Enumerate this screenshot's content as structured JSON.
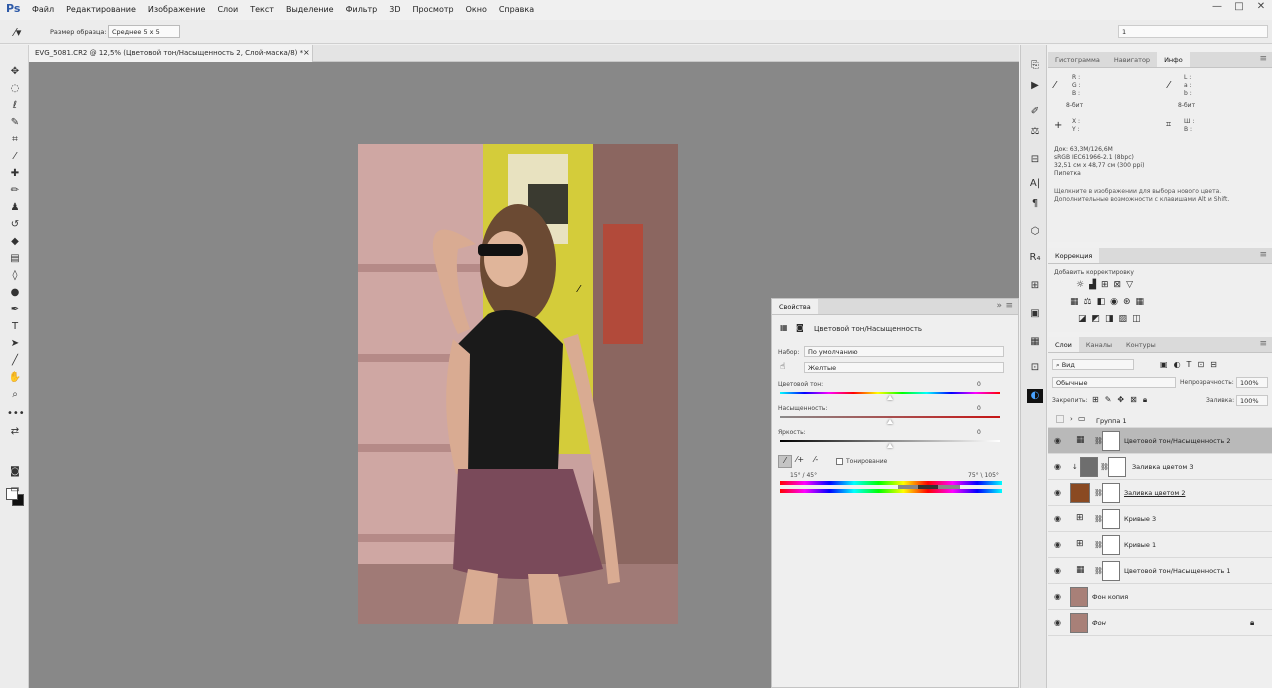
{
  "app": {
    "logo": "Ps"
  },
  "menu": [
    "Файл",
    "Редактирование",
    "Изображение",
    "Слои",
    "Текст",
    "Выделение",
    "Фильтр",
    "3D",
    "Просмотр",
    "Окно",
    "Справка"
  ],
  "window_controls": [
    "—",
    "□",
    "✕"
  ],
  "options": {
    "sample_label": "Размер образца:",
    "sample_value": "Среднее 5 x 5",
    "right_value": "1"
  },
  "document": {
    "tab_title": "EVG_5081.CR2 @ 12,5% (Цветовой тон/Насыщенность 2, Слой-маска/8) *",
    "close": "×"
  },
  "info_panel": {
    "tabs": [
      "Гистограмма",
      "Навигатор",
      "Инфо"
    ],
    "active_tab": "Инфо",
    "rgb": [
      "R :",
      "G :",
      "B :"
    ],
    "lab": [
      "L :",
      "a :",
      "b :"
    ],
    "bit_left": "8-бит",
    "bit_right": "8-бит",
    "xy": [
      "X :",
      "Y :"
    ],
    "wh": [
      "Ш :",
      "В :"
    ],
    "doc_info": [
      "Док: 63,3M/126,6M",
      "sRGB IEC61966-2.1 (8bpc)",
      "32,51 см x 48,77 см (300 ppi)",
      "Пипетка"
    ],
    "hint": [
      "Щелкните в изображении для выбора нового цвета.",
      "Дополнительные возможности с клавишами Alt и Shift."
    ]
  },
  "adjustments": {
    "tab": "Коррекция",
    "add_label": "Добавить корректировку"
  },
  "layers": {
    "tabs": [
      "Слои",
      "Каналы",
      "Контуры"
    ],
    "active_tab": "Слои",
    "filter": "Вид",
    "blend_mode": "Обычные",
    "opacity_label": "Непрозрачность:",
    "opacity": "100%",
    "lock_label": "Закрепить:",
    "fill_label": "Заливка:",
    "fill": "100%",
    "group": "Группа 1",
    "rows": [
      {
        "name": "Цветовой тон/Насыщенность 2"
      },
      {
        "name": "Заливка цветом 3"
      },
      {
        "name": "Заливка цветом 2"
      },
      {
        "name": "Кривые 3"
      },
      {
        "name": "Кривые 1"
      },
      {
        "name": "Цветовой тон/Насыщенность 1"
      },
      {
        "name": "Фон копия"
      },
      {
        "name": "Фон"
      }
    ],
    "fill2_color": "#8a4a22",
    "fill3_color": "#6e6e6e"
  },
  "properties": {
    "tab": "Свойства",
    "title": "Цветовой тон/Насыщенность",
    "preset_label": "Набор:",
    "preset_value": "По умолчанию",
    "channel_value": "Желтые",
    "hue_label": "Цветовой тон:",
    "hue_value": "0",
    "sat_label": "Насыщенность:",
    "sat_value": "0",
    "light_label": "Яркость:",
    "light_value": "0",
    "colorize_label": "Тонирование",
    "range_left": "15° / 45°",
    "range_right": "75° \\ 105°",
    "expand": "»",
    "menu": "≡"
  }
}
